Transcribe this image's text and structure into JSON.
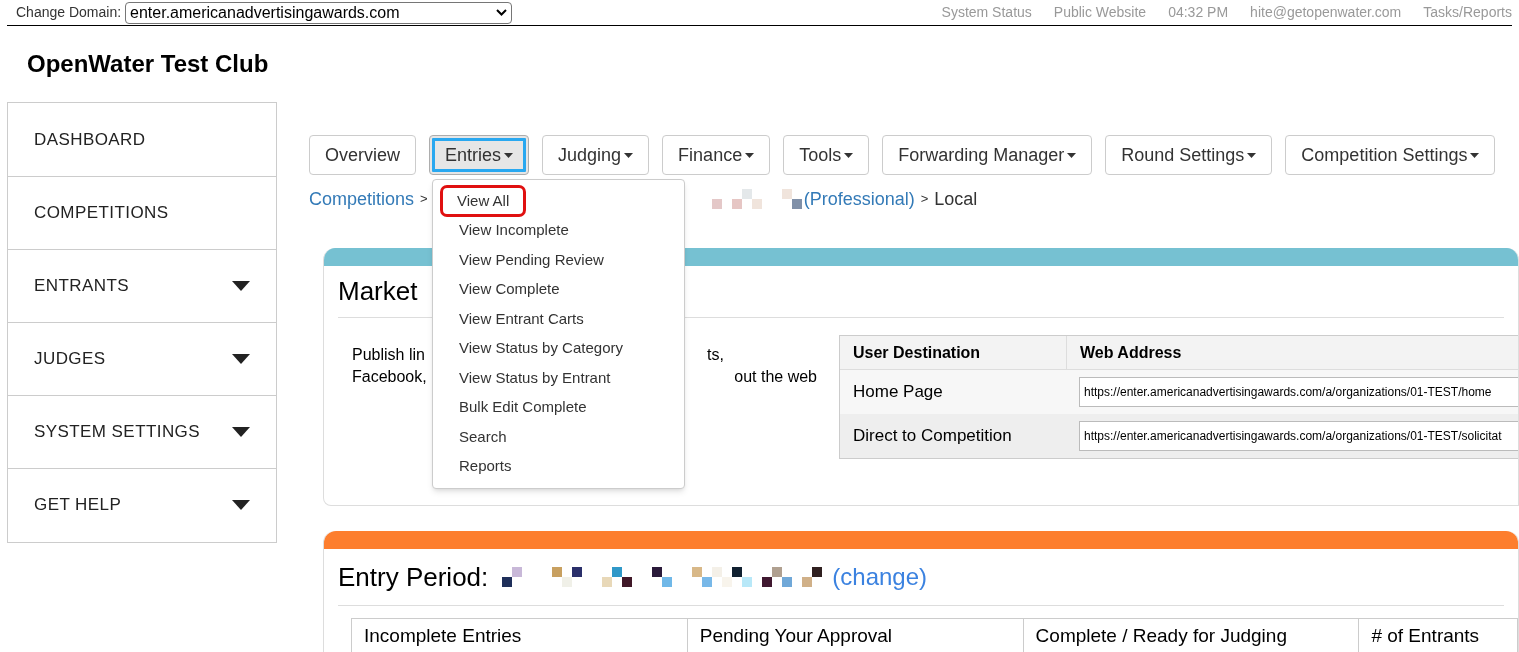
{
  "top_bar": {
    "domain_label": "Change Domain:",
    "domain_value": "enter.americanadvertisingawards.com",
    "links": [
      "System Status",
      "Public Website",
      "04:32 PM",
      "hite@getopenwater.com",
      "Tasks/Reports"
    ]
  },
  "site_title": "OpenWater Test Club",
  "sidebar": {
    "items": [
      {
        "label": "DASHBOARD",
        "expandable": false
      },
      {
        "label": "COMPETITIONS",
        "expandable": false
      },
      {
        "label": "ENTRANTS",
        "expandable": true
      },
      {
        "label": "JUDGES",
        "expandable": true
      },
      {
        "label": "SYSTEM SETTINGS",
        "expandable": true
      },
      {
        "label": "GET HELP",
        "expandable": true
      }
    ]
  },
  "tabs": [
    {
      "label": "Overview",
      "dropdown": false,
      "selected": false
    },
    {
      "label": "Entries",
      "dropdown": true,
      "selected": true
    },
    {
      "label": "Judging",
      "dropdown": true,
      "selected": false
    },
    {
      "label": "Finance",
      "dropdown": true,
      "selected": false
    },
    {
      "label": "Tools",
      "dropdown": true,
      "selected": false
    },
    {
      "label": "Forwarding Manager",
      "dropdown": true,
      "selected": false
    },
    {
      "label": "Round Settings",
      "dropdown": true,
      "selected": false
    },
    {
      "label": "Competition Settings",
      "dropdown": true,
      "selected": false
    }
  ],
  "entries_menu": [
    {
      "label": "View All",
      "highlighted": true
    },
    {
      "label": "View Incomplete",
      "highlighted": false
    },
    {
      "label": "View Pending Review",
      "highlighted": false
    },
    {
      "label": "View Complete",
      "highlighted": false
    },
    {
      "label": "View Entrant Carts",
      "highlighted": false
    },
    {
      "label": "View Status by Category",
      "highlighted": false
    },
    {
      "label": "View Status by Entrant",
      "highlighted": false
    },
    {
      "label": "Bulk Edit Complete",
      "highlighted": false
    },
    {
      "label": "Search",
      "highlighted": false
    },
    {
      "label": "Reports",
      "highlighted": false
    }
  ],
  "breadcrumb": {
    "first": "Competitions",
    "separator_1": ">",
    "second": "(Professional)",
    "separator_2": ">",
    "current": "Local"
  },
  "market_card": {
    "title": "Market",
    "text_line_1_start": "Publish lin",
    "text_line_1_end": "ts,",
    "text_line_2_start": "Facebook,",
    "text_line_2_end": "out the web",
    "table": {
      "columns": [
        "User Destination",
        "Web Address"
      ],
      "rows": [
        {
          "destination": "Home Page",
          "address": "https://enter.americanadvertisingawards.com/a/organizations/01-TEST/home"
        },
        {
          "destination": "Direct to Competition",
          "address": "https://enter.americanadvertisingawards.com/a/organizations/01-TEST/solicitat"
        }
      ]
    }
  },
  "entry_period_card": {
    "title": "Entry Period:",
    "change_link": "(change)",
    "columns": [
      "Incomplete Entries",
      "Pending Your Approval",
      "Complete / Ready for Judging",
      "# of Entrants"
    ]
  }
}
